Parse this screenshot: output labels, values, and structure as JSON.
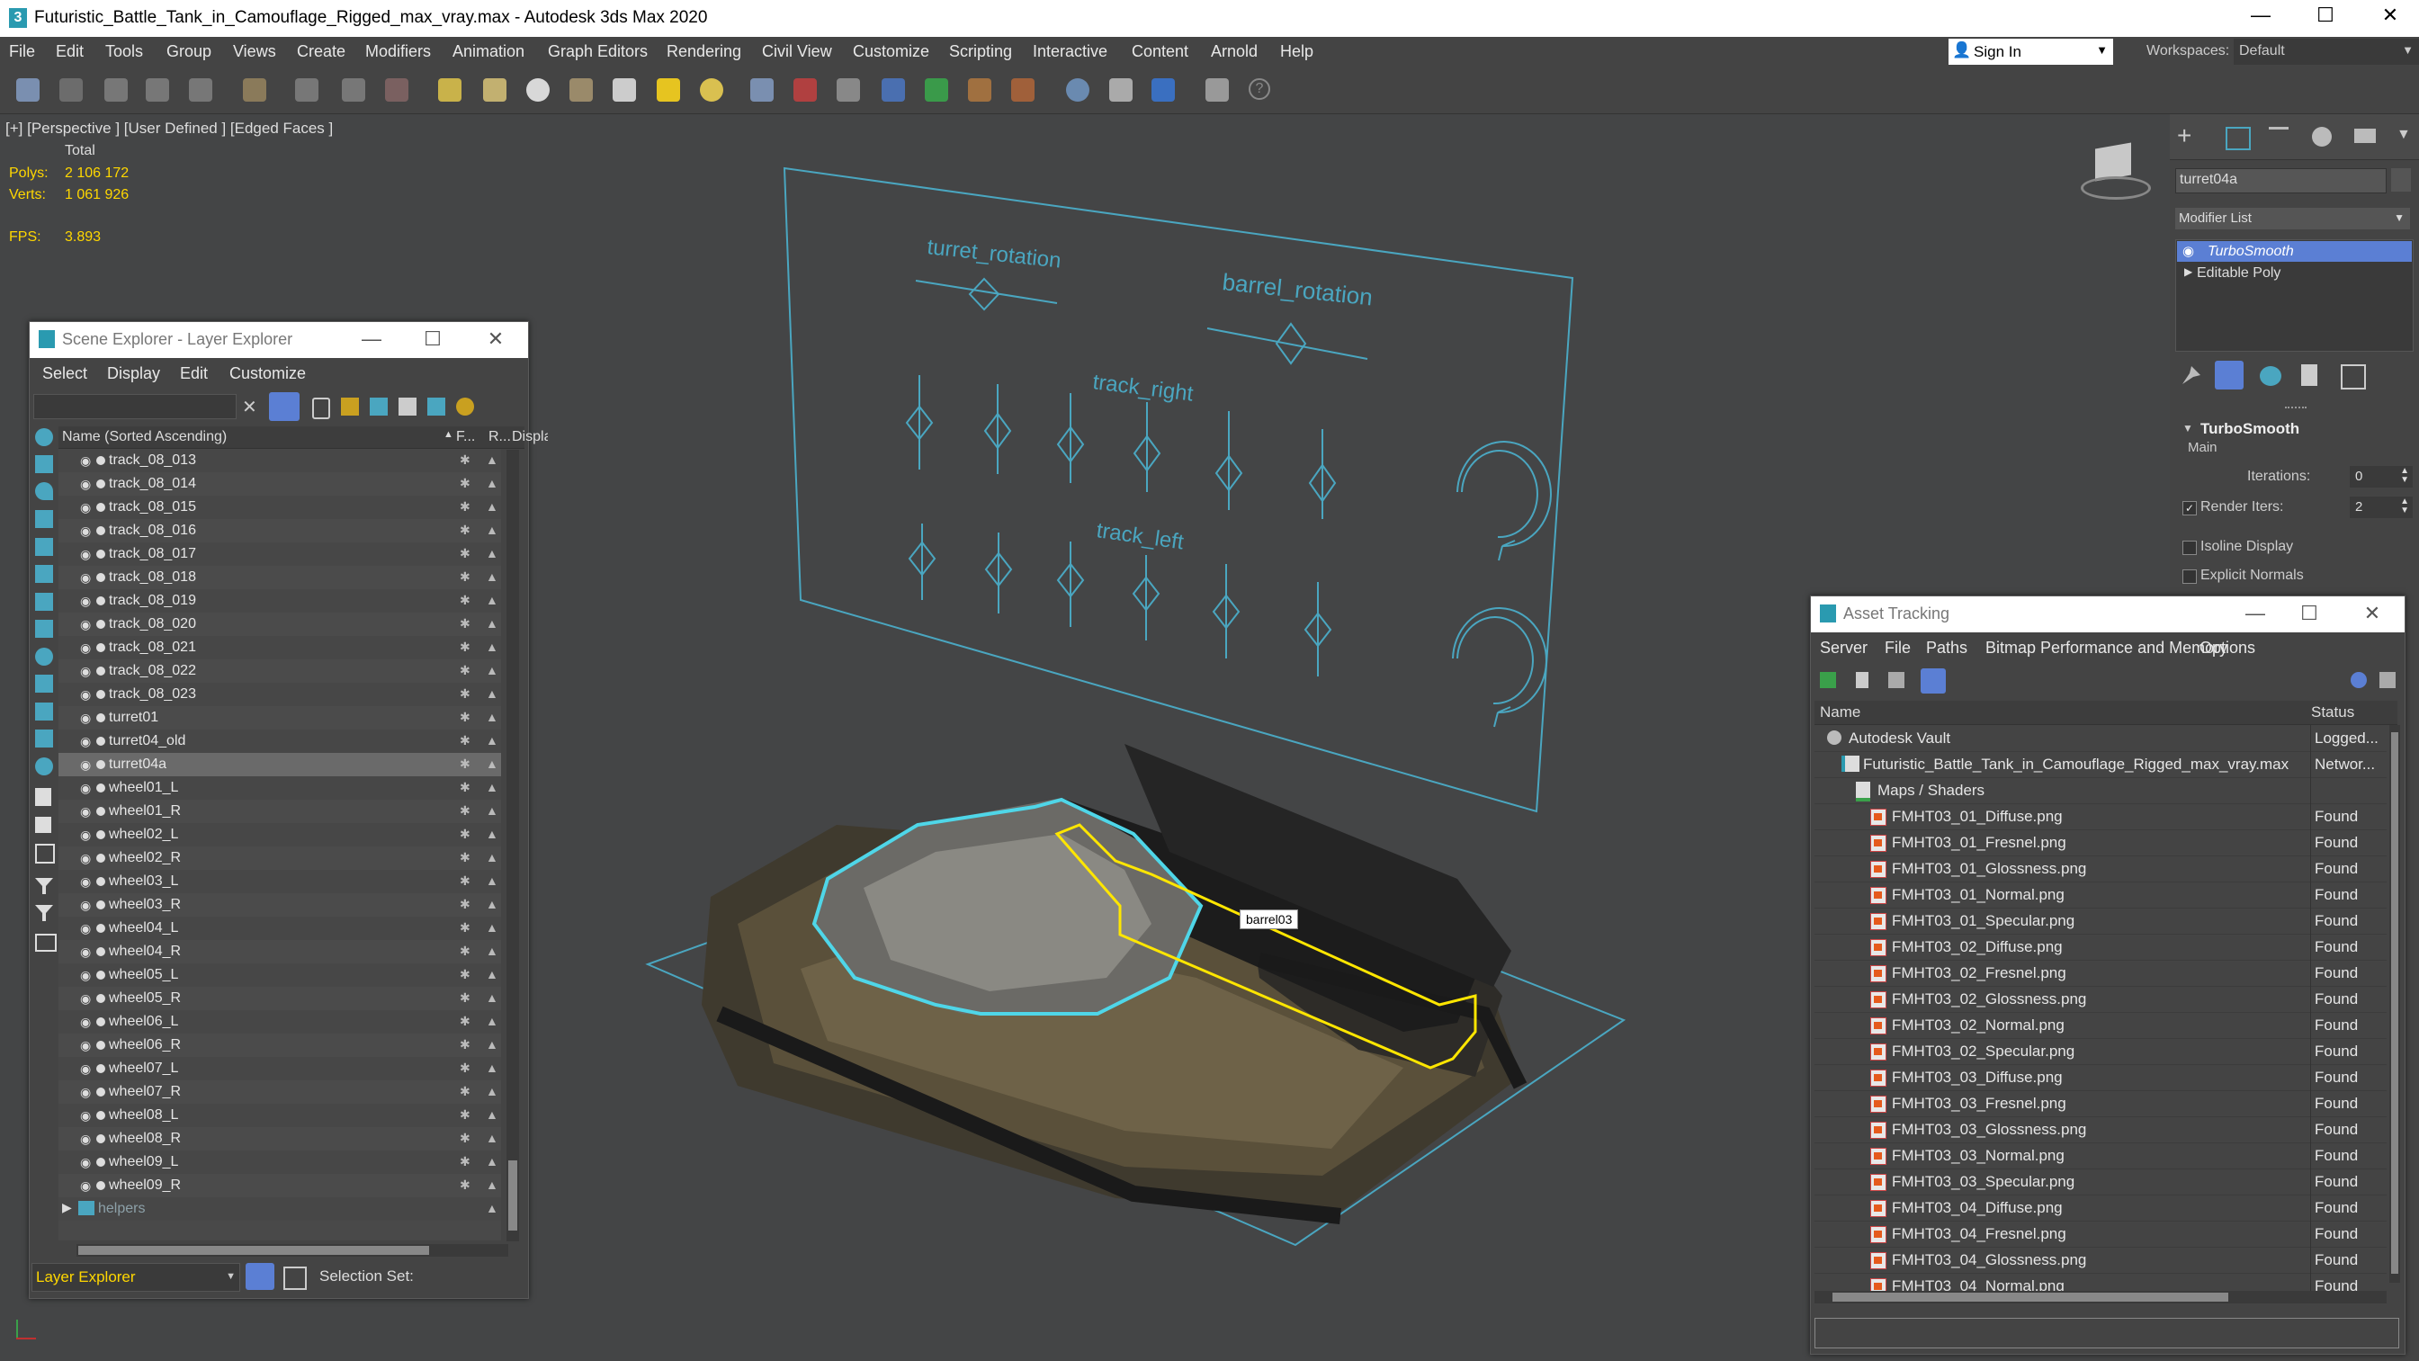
{
  "window": {
    "title": "Futuristic_Battle_Tank_in_Camouflage_Rigged_max_vray.max - Autodesk 3ds Max 2020",
    "app_logo": "3",
    "controls": [
      "—",
      "☐",
      "✕"
    ]
  },
  "menu": [
    "File",
    "Edit",
    "Tools",
    "Group",
    "Views",
    "Create",
    "Modifiers",
    "Animation",
    "Graph Editors",
    "Rendering",
    "Civil View",
    "Customize",
    "Scripting",
    "Interactive",
    "Content",
    "Arnold",
    "Help"
  ],
  "signin": {
    "label": "Sign In"
  },
  "workspace": {
    "label": "Workspaces:",
    "value": "Default"
  },
  "viewport": {
    "label": "[+] [Perspective ] [User Defined ] [Edged Faces ]",
    "stats": {
      "total_label": "Total",
      "polys_label": "Polys:",
      "polys": "2 106 172",
      "verts_label": "Verts:",
      "verts": "1 061 926",
      "fps_label": "FPS:",
      "fps": "3.893"
    },
    "board_labels": {
      "turret_rotation": "turret_rotation",
      "barrel_rotation": "barrel_rotation",
      "track_right": "track_right",
      "track_left": "track_left"
    },
    "tooltip": "barrel03"
  },
  "command_panel": {
    "object_name": "turret04a",
    "modifier_list_label": "Modifier List",
    "stack": [
      "TurboSmooth",
      "Editable Poly"
    ],
    "rollout_title": "TurboSmooth",
    "main_label": "Main",
    "iterations_label": "Iterations:",
    "iterations_value": "0",
    "render_iters_label": "Render Iters:",
    "render_iters_value": "2",
    "isoline_label": "Isoline Display",
    "explicit_normals_label": "Explicit Normals"
  },
  "scene_explorer": {
    "title": "Scene Explorer - Layer Explorer",
    "menu": [
      "Select",
      "Display",
      "Edit",
      "Customize"
    ],
    "col_name": "Name (Sorted Ascending)",
    "col_f": "F...",
    "col_r": "R...",
    "col_d": "Displa",
    "rows": [
      "track_08_013",
      "track_08_014",
      "track_08_015",
      "track_08_016",
      "track_08_017",
      "track_08_018",
      "track_08_019",
      "track_08_020",
      "track_08_021",
      "track_08_022",
      "track_08_023",
      "turret01",
      "turret04_old",
      "turret04a",
      "wheel01_L",
      "wheel01_R",
      "wheel02_L",
      "wheel02_R",
      "wheel03_L",
      "wheel03_R",
      "wheel04_L",
      "wheel04_R",
      "wheel05_L",
      "wheel05_R",
      "wheel06_L",
      "wheel06_R",
      "wheel07_L",
      "wheel07_R",
      "wheel08_L",
      "wheel08_R",
      "wheel09_L",
      "wheel09_R"
    ],
    "selected": "turret04a",
    "layer_row": "helpers",
    "footer_dropdown": "Layer Explorer",
    "selection_set_label": "Selection Set:"
  },
  "asset_tracking": {
    "title": "Asset Tracking",
    "menu": [
      "Server",
      "File",
      "Paths",
      "Bitmap Performance and Memory",
      "Options"
    ],
    "col_name": "Name",
    "col_status": "Status",
    "rows": [
      {
        "name": "Autodesk Vault",
        "status": "Logged...",
        "indent": 0
      },
      {
        "name": "Futuristic_Battle_Tank_in_Camouflage_Rigged_max_vray.max",
        "status": "Networ...",
        "indent": 1
      },
      {
        "name": "Maps / Shaders",
        "status": "",
        "indent": 2
      },
      {
        "name": "FMHT03_01_Diffuse.png",
        "status": "Found",
        "indent": 3
      },
      {
        "name": "FMHT03_01_Fresnel.png",
        "status": "Found",
        "indent": 3
      },
      {
        "name": "FMHT03_01_Glossness.png",
        "status": "Found",
        "indent": 3
      },
      {
        "name": "FMHT03_01_Normal.png",
        "status": "Found",
        "indent": 3
      },
      {
        "name": "FMHT03_01_Specular.png",
        "status": "Found",
        "indent": 3
      },
      {
        "name": "FMHT03_02_Diffuse.png",
        "status": "Found",
        "indent": 3
      },
      {
        "name": "FMHT03_02_Fresnel.png",
        "status": "Found",
        "indent": 3
      },
      {
        "name": "FMHT03_02_Glossness.png",
        "status": "Found",
        "indent": 3
      },
      {
        "name": "FMHT03_02_Normal.png",
        "status": "Found",
        "indent": 3
      },
      {
        "name": "FMHT03_02_Specular.png",
        "status": "Found",
        "indent": 3
      },
      {
        "name": "FMHT03_03_Diffuse.png",
        "status": "Found",
        "indent": 3
      },
      {
        "name": "FMHT03_03_Fresnel.png",
        "status": "Found",
        "indent": 3
      },
      {
        "name": "FMHT03_03_Glossness.png",
        "status": "Found",
        "indent": 3
      },
      {
        "name": "FMHT03_03_Normal.png",
        "status": "Found",
        "indent": 3
      },
      {
        "name": "FMHT03_03_Specular.png",
        "status": "Found",
        "indent": 3
      },
      {
        "name": "FMHT03_04_Diffuse.png",
        "status": "Found",
        "indent": 3
      },
      {
        "name": "FMHT03_04_Fresnel.png",
        "status": "Found",
        "indent": 3
      },
      {
        "name": "FMHT03_04_Glossness.png",
        "status": "Found",
        "indent": 3
      },
      {
        "name": "FMHT03_04_Normal.png",
        "status": "Found",
        "indent": 3
      }
    ]
  },
  "colors": {
    "accent": "#5b7fd4",
    "selection_cyan": "#4fd6e8",
    "selection_yellow": "#ffe600",
    "stat_yellow": "#ffd700",
    "gizmo_cyan": "#4aa6c0"
  }
}
